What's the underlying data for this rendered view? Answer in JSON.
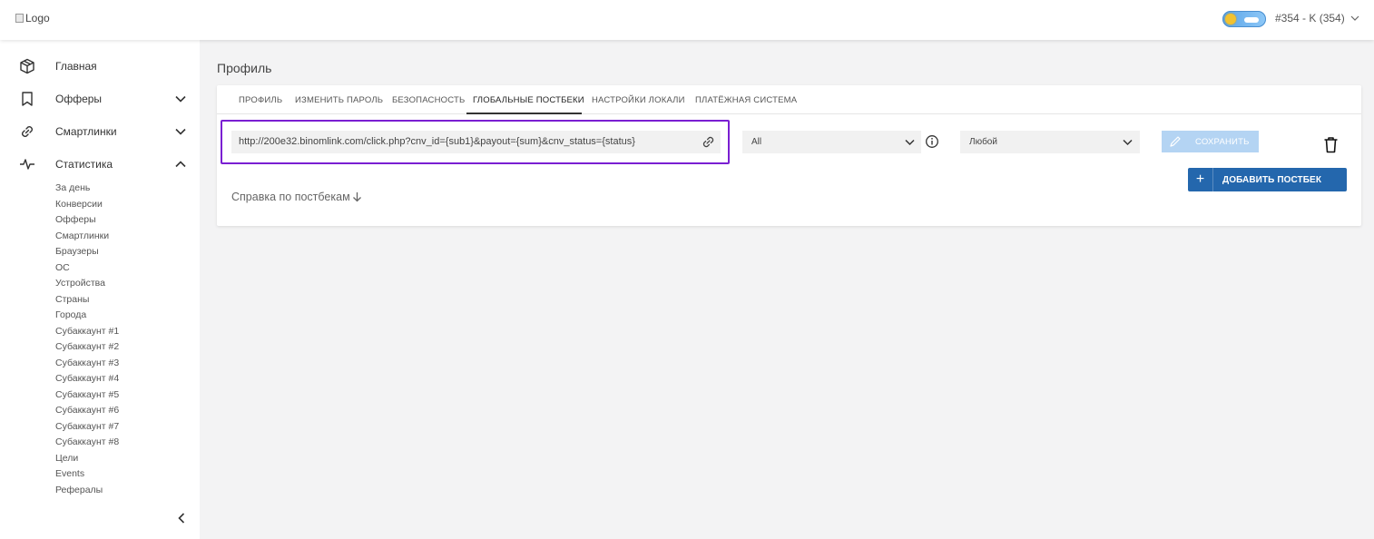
{
  "header": {
    "logo_alt": "Logo",
    "account_label": "#354 - K (354)"
  },
  "sidebar": {
    "items": [
      {
        "label": "Главная",
        "icon": "cube-icon",
        "chevron": "none"
      },
      {
        "label": "Офферы",
        "icon": "bookmark-icon",
        "chevron": "down"
      },
      {
        "label": "Смартлинки",
        "icon": "link-icon",
        "chevron": "down"
      },
      {
        "label": "Статистика",
        "icon": "pulse-icon",
        "chevron": "up"
      }
    ],
    "stat_subitems": [
      "За день",
      "Конверсии",
      "Офферы",
      "Смартлинки",
      "Браузеры",
      "ОС",
      "Устройства",
      "Страны",
      "Города",
      "Субаккаунт #1",
      "Субаккаунт #2",
      "Субаккаунт #3",
      "Субаккаунт #4",
      "Субаккаунт #5",
      "Субаккаунт #6",
      "Субаккаунт #7",
      "Субаккаунт #8",
      "Цели",
      "Events",
      "Рефералы"
    ]
  },
  "main": {
    "page_title": "Профиль",
    "tabs": [
      {
        "label": "ПРОФИЛЬ",
        "active": false
      },
      {
        "label": "ИЗМЕНИТЬ ПАРОЛЬ",
        "active": false
      },
      {
        "label": "БЕЗОПАСНОСТЬ",
        "active": false
      },
      {
        "label": "ГЛОБАЛЬНЫЕ ПОСТБЕКИ",
        "active": true
      },
      {
        "label": "НАСТРОЙКИ ЛОКАЛИ",
        "active": false
      },
      {
        "label": "ПЛАТЁЖНАЯ СИСТЕМА",
        "active": false
      }
    ],
    "postback": {
      "url": "http://200e32.binomlink.com/click.php?cnv_id={sub1}&payout={sum}&cnv_status={status}",
      "offer_select": "All",
      "status_select": "Любой",
      "save_label": "СОХРАНИТЬ"
    },
    "add_postback_label": "ДОБАВИТЬ ПОСТБЕК",
    "help_link": "Справка по постбекам"
  },
  "colors": {
    "highlight": "#7a1fd2",
    "primary": "#2467ad",
    "save_disabled": "#b4d4f3"
  }
}
